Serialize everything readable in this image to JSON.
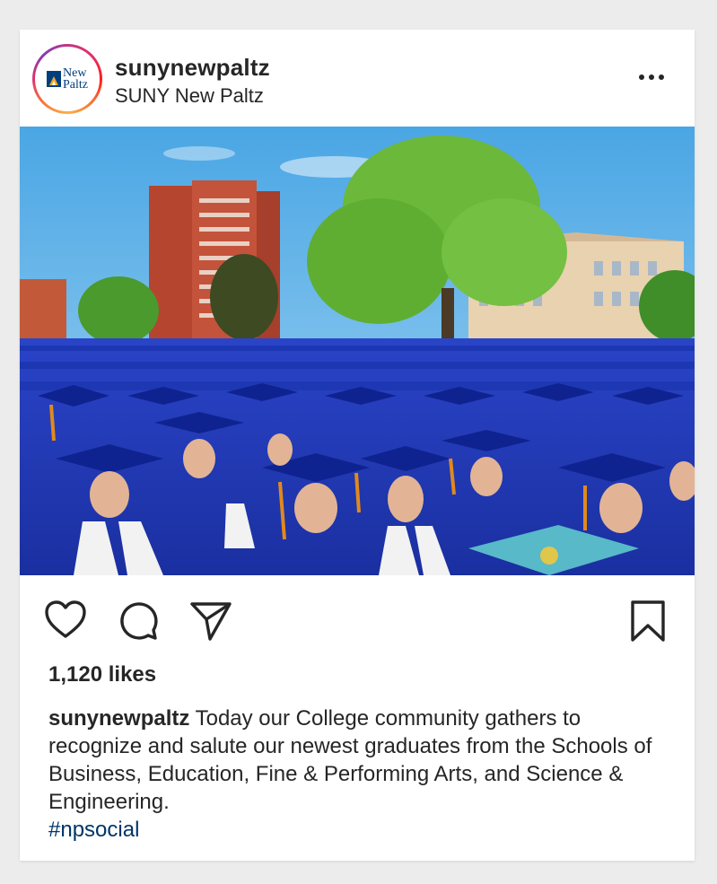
{
  "post": {
    "username": "sunynewpaltz",
    "account_name": "SUNY New Paltz",
    "avatar": {
      "logo_text_line1": "New",
      "logo_text_line2": "Paltz",
      "brand_color": "#003e7e",
      "accent_color": "#f5a623"
    },
    "more_icon": "more-horizontal-icon",
    "likes_text": "1,120 likes",
    "caption_user": "sunynewpaltz",
    "caption_text": " Today our College community gathers to recognize and salute our newest graduates from the Schools of Business, Education, Fine & Performing Arts, and Science & Engineering.",
    "hashtag": "#npsocial",
    "hashtag_color": "#003569"
  },
  "photo": {
    "subject": "graduates-in-blue-caps-and-gowns",
    "sky_color": "#6fb8e8",
    "gown_color": "#1f3ec4",
    "tassel_color": "#e08a1c"
  },
  "actions": {
    "like_icon": "heart-icon",
    "comment_icon": "comment-icon",
    "share_icon": "share-icon",
    "save_icon": "bookmark-icon"
  }
}
